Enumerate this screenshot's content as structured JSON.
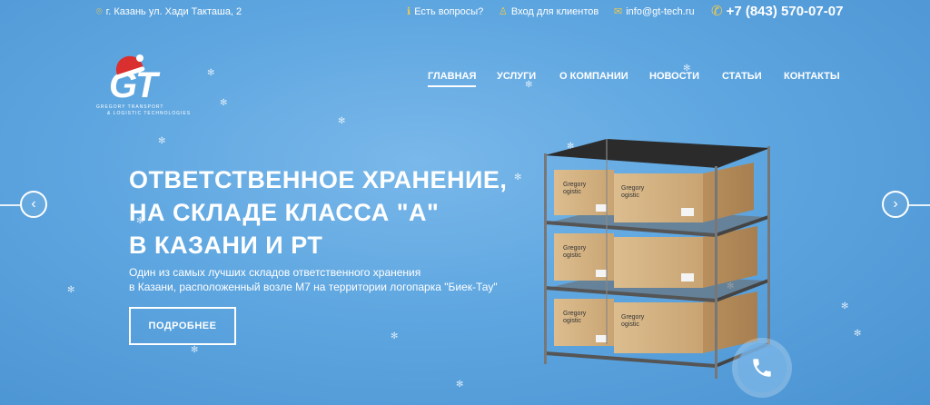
{
  "topbar": {
    "address": "г. Казань ул. Хади Такташа, 2",
    "address_icon": "map-pin-icon",
    "questions": "Есть вопросы?",
    "questions_icon": "info-icon",
    "client_login": "Вход для клиентов",
    "client_icon": "user-icon",
    "email": "info@gt-tech.ru",
    "email_icon": "mail-icon",
    "phone": "+7 (843) 570-07-07",
    "phone_icon": "phone-icon",
    "accent_color": "#f2c94c"
  },
  "logo": {
    "mark": "GT",
    "subtitle_1": "GREGORY TRANSPORT",
    "subtitle_2": "& LOGISTIC TECHNOLOGIES"
  },
  "nav": {
    "items": [
      {
        "label": "ГЛАВНАЯ",
        "active": true
      },
      {
        "label": "УСЛУГИ",
        "active": false
      },
      {
        "label": "О КОМПАНИИ",
        "active": false
      },
      {
        "label": "НОВОСТИ",
        "active": false
      },
      {
        "label": "СТАТЬИ",
        "active": false
      },
      {
        "label": "КОНТАКТЫ",
        "active": false
      }
    ]
  },
  "hero": {
    "title_lines": [
      "ОТВЕТСТВЕННОЕ ХРАНЕНИЕ,",
      "НА СКЛАДЕ КЛАССА \"А\"",
      "В КАЗАНИ И РТ"
    ],
    "description_lines": [
      "Один из самых лучших складов ответственного хранения",
      "в Казани, расположенный возле М7 на территории логопарка \"Биек-Тау\""
    ],
    "button_label": "ПОДРОБНЕЕ",
    "box_label_1": "Gregory",
    "box_label_2": "ogistic"
  },
  "slider": {
    "prev_icon": "chevron-left-icon",
    "next_icon": "chevron-right-icon"
  },
  "call_widget": {
    "icon": "phone-handset-icon"
  },
  "colors": {
    "background": "#5ea6e0",
    "box": "#d8b888",
    "shelf_top": "#2a2a2a"
  }
}
